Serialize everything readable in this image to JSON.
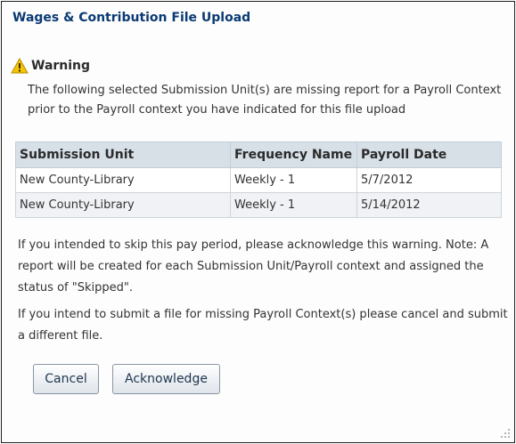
{
  "dialog": {
    "title": "Wages & Contribution File Upload"
  },
  "warning": {
    "icon": "warning-icon",
    "label": "Warning",
    "message": "The following selected Submission Unit(s) are missing report for a Payroll Context prior to the Payroll context you have indicated for this file upload"
  },
  "table": {
    "headers": [
      "Submission Unit",
      "Frequency Name",
      "Payroll Date"
    ],
    "rows": [
      [
        "New County-Library",
        "Weekly - 1",
        "5/7/2012"
      ],
      [
        "New County-Library",
        "Weekly - 1",
        "5/14/2012"
      ]
    ]
  },
  "info": {
    "line1": "If you intended to skip this pay period, please acknowledge this warning. Note: A report will be created for each Submission Unit/Payroll context and assigned the status of \"Skipped\".",
    "line2": "If you intend to submit a file for missing Payroll Context(s) please cancel and submit a different file."
  },
  "buttons": {
    "cancel": "Cancel",
    "acknowledge": "Acknowledge"
  },
  "colors": {
    "title": "#0b3a74",
    "header_bg": "#d7dfe7",
    "alt_row_bg": "#f0f2f5",
    "warning_yellow": "#f5c400"
  }
}
